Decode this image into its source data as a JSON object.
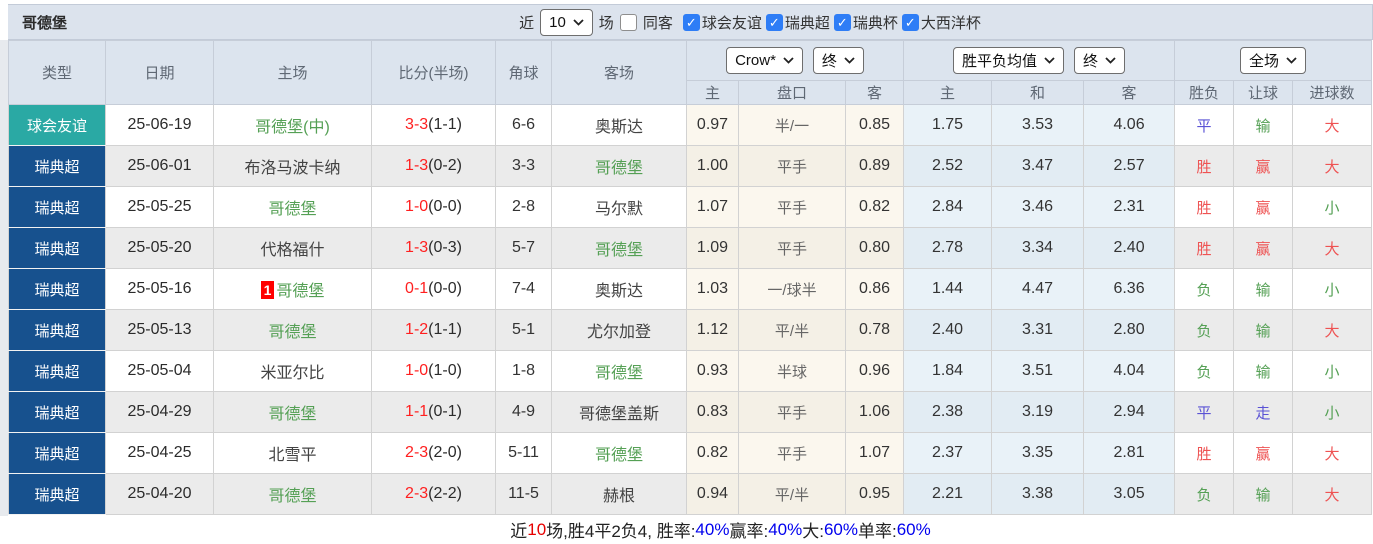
{
  "top_bar": {
    "title": "哥德堡",
    "near_label": "近",
    "select_value": "10",
    "games_label": "场",
    "same_away_label": "同客",
    "same_away_checked": false,
    "filters": [
      {
        "label": "球会友谊",
        "checked": true
      },
      {
        "label": "瑞典超",
        "checked": true
      },
      {
        "label": "瑞典杯",
        "checked": true
      },
      {
        "label": "大西洋杯",
        "checked": true
      }
    ]
  },
  "table": {
    "columns": [
      "类型",
      "日期",
      "主场",
      "比分(半场)",
      "角球",
      "客场"
    ],
    "odds_group": {
      "select_bookmaker": "Crow*",
      "select_time": "终",
      "sub": [
        "主",
        "盘口",
        "客"
      ]
    },
    "avg_group": {
      "select_type": "胜平负均值",
      "select_time": "终",
      "sub": [
        "主",
        "和",
        "客"
      ]
    },
    "result_group": {
      "select_scope": "全场",
      "sub": [
        "胜负",
        "让球",
        "进球数"
      ]
    },
    "rows": [
      {
        "type": "球会友谊",
        "league": "friendly",
        "date": "25-06-19",
        "home": "哥德堡(中)",
        "home_green": true,
        "home_badge": "",
        "score": "3-3",
        "half": "(1-1)",
        "corner": "6-6",
        "away": "奥斯达",
        "away_green": false,
        "asian": [
          "0.97",
          "半/一",
          "0.85"
        ],
        "avg": [
          "1.75",
          "3.53",
          "4.06"
        ],
        "results": [
          [
            "平",
            "blue"
          ],
          [
            "输",
            "green"
          ],
          [
            "大",
            "red"
          ]
        ]
      },
      {
        "type": "瑞典超",
        "league": "league",
        "date": "25-06-01",
        "home": "布洛马波卡纳",
        "home_green": false,
        "home_badge": "",
        "score": "1-3",
        "half": "(0-2)",
        "corner": "3-3",
        "away": "哥德堡",
        "away_green": true,
        "asian": [
          "1.00",
          "平手",
          "0.89"
        ],
        "avg": [
          "2.52",
          "3.47",
          "2.57"
        ],
        "results": [
          [
            "胜",
            "red"
          ],
          [
            "赢",
            "red"
          ],
          [
            "大",
            "red"
          ]
        ]
      },
      {
        "type": "瑞典超",
        "league": "league",
        "date": "25-05-25",
        "home": "哥德堡",
        "home_green": true,
        "home_badge": "",
        "score": "1-0",
        "half": "(0-0)",
        "corner": "2-8",
        "away": "马尔默",
        "away_green": false,
        "asian": [
          "1.07",
          "平手",
          "0.82"
        ],
        "avg": [
          "2.84",
          "3.46",
          "2.31"
        ],
        "results": [
          [
            "胜",
            "red"
          ],
          [
            "赢",
            "red"
          ],
          [
            "小",
            "green"
          ]
        ]
      },
      {
        "type": "瑞典超",
        "league": "league",
        "date": "25-05-20",
        "home": "代格福什",
        "home_green": false,
        "home_badge": "",
        "score": "1-3",
        "half": "(0-3)",
        "corner": "5-7",
        "away": "哥德堡",
        "away_green": true,
        "asian": [
          "1.09",
          "平手",
          "0.80"
        ],
        "avg": [
          "2.78",
          "3.34",
          "2.40"
        ],
        "results": [
          [
            "胜",
            "red"
          ],
          [
            "赢",
            "red"
          ],
          [
            "大",
            "red"
          ]
        ]
      },
      {
        "type": "瑞典超",
        "league": "league",
        "date": "25-05-16",
        "home": "哥德堡",
        "home_green": true,
        "home_badge": "1",
        "score": "0-1",
        "half": "(0-0)",
        "corner": "7-4",
        "away": "奥斯达",
        "away_green": false,
        "asian": [
          "1.03",
          "一/球半",
          "0.86"
        ],
        "avg": [
          "1.44",
          "4.47",
          "6.36"
        ],
        "results": [
          [
            "负",
            "green"
          ],
          [
            "输",
            "green"
          ],
          [
            "小",
            "green"
          ]
        ]
      },
      {
        "type": "瑞典超",
        "league": "league",
        "date": "25-05-13",
        "home": "哥德堡",
        "home_green": true,
        "home_badge": "",
        "score": "1-2",
        "half": "(1-1)",
        "corner": "5-1",
        "away": "尤尔加登",
        "away_green": false,
        "asian": [
          "1.12",
          "平/半",
          "0.78"
        ],
        "avg": [
          "2.40",
          "3.31",
          "2.80"
        ],
        "results": [
          [
            "负",
            "green"
          ],
          [
            "输",
            "green"
          ],
          [
            "大",
            "red"
          ]
        ]
      },
      {
        "type": "瑞典超",
        "league": "league",
        "date": "25-05-04",
        "home": "米亚尔比",
        "home_green": false,
        "home_badge": "",
        "score": "1-0",
        "half": "(1-0)",
        "corner": "1-8",
        "away": "哥德堡",
        "away_green": true,
        "asian": [
          "0.93",
          "半球",
          "0.96"
        ],
        "avg": [
          "1.84",
          "3.51",
          "4.04"
        ],
        "results": [
          [
            "负",
            "green"
          ],
          [
            "输",
            "green"
          ],
          [
            "小",
            "green"
          ]
        ]
      },
      {
        "type": "瑞典超",
        "league": "league",
        "date": "25-04-29",
        "home": "哥德堡",
        "home_green": true,
        "home_badge": "",
        "score": "1-1",
        "half": "(0-1)",
        "corner": "4-9",
        "away": "哥德堡盖斯",
        "away_green": false,
        "asian": [
          "0.83",
          "平手",
          "1.06"
        ],
        "avg": [
          "2.38",
          "3.19",
          "2.94"
        ],
        "results": [
          [
            "平",
            "blue"
          ],
          [
            "走",
            "blue"
          ],
          [
            "小",
            "green"
          ]
        ]
      },
      {
        "type": "瑞典超",
        "league": "league",
        "date": "25-04-25",
        "home": "北雪平",
        "home_green": false,
        "home_badge": "",
        "score": "2-3",
        "half": "(2-0)",
        "corner": "5-11",
        "away": "哥德堡",
        "away_green": true,
        "asian": [
          "0.82",
          "平手",
          "1.07"
        ],
        "avg": [
          "2.37",
          "3.35",
          "2.81"
        ],
        "results": [
          [
            "胜",
            "red"
          ],
          [
            "赢",
            "red"
          ],
          [
            "大",
            "red"
          ]
        ]
      },
      {
        "type": "瑞典超",
        "league": "league",
        "date": "25-04-20",
        "home": "哥德堡",
        "home_green": true,
        "home_badge": "",
        "score": "2-3",
        "half": "(2-2)",
        "corner": "11-5",
        "away": "赫根",
        "away_green": false,
        "asian": [
          "0.94",
          "平/半",
          "0.95"
        ],
        "avg": [
          "2.21",
          "3.38",
          "3.05"
        ],
        "results": [
          [
            "负",
            "green"
          ],
          [
            "输",
            "green"
          ],
          [
            "大",
            "red"
          ]
        ]
      }
    ]
  },
  "footer": {
    "segments": [
      {
        "text": "近",
        "color": "black"
      },
      {
        "text": "10",
        "color": "red"
      },
      {
        "text": "场,胜4平2负4, 胜率:",
        "color": "black"
      },
      {
        "text": "40%",
        "color": "blue"
      },
      {
        "text": " 赢率:",
        "color": "black"
      },
      {
        "text": "40%",
        "color": "blue"
      },
      {
        "text": " 大:",
        "color": "black"
      },
      {
        "text": "60%",
        "color": "blue"
      },
      {
        "text": " 单率:",
        "color": "black"
      },
      {
        "text": "60%",
        "color": "blue"
      }
    ]
  },
  "colors": {
    "teal": "#2aa9a4",
    "league_blue": "#17518e",
    "green": "#55a055",
    "res_red": "#ee5353",
    "res_blue": "#5a52d5",
    "score_red": "#ff1f1f",
    "checkbox_blue": "#2e7df6",
    "header_bg": "#dce4ee"
  }
}
